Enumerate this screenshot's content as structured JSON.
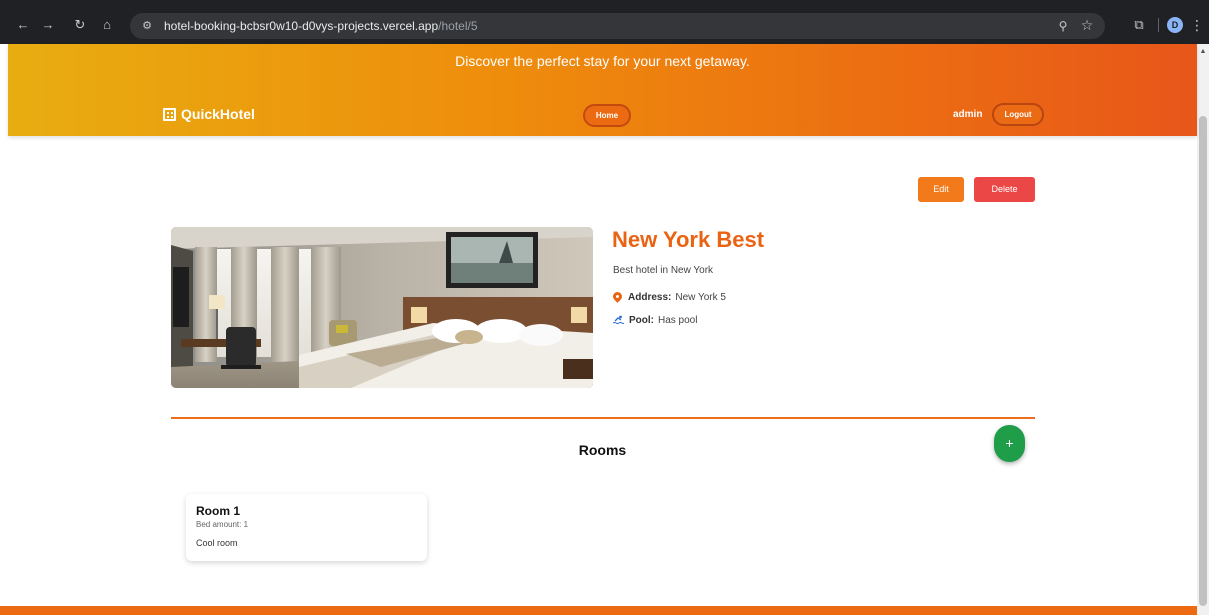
{
  "browser": {
    "url_host": "hotel-booking-bcbsr0w10-d0vys-projects.vercel.app",
    "url_path": "/hotel/5",
    "profile_initial": "D",
    "icons": [
      "back-icon",
      "forward-icon",
      "reload-icon",
      "home-icon",
      "site-settings-icon",
      "zoom-icon",
      "bookmark-star-icon",
      "extensions-icon",
      "profile-avatar",
      "menu-kebab-icon"
    ]
  },
  "header": {
    "tagline": "Discover the perfect stay for your next getaway.",
    "brand": "QuickHotel",
    "home_label": "Home",
    "username": "admin",
    "logout_label": "Logout",
    "gradient_colors": [
      "#e8ad10",
      "#e8561a"
    ]
  },
  "actions": {
    "edit_label": "Edit",
    "delete_label": "Delete",
    "edit_color": "#f27a1a",
    "delete_color": "#ec4747"
  },
  "hotel": {
    "name": "New York Best",
    "description": "Best hotel in New York",
    "address_label": "Address:",
    "address": "New York 5",
    "pool_label": "Pool:",
    "pool": "Has pool"
  },
  "rooms": {
    "title": "Rooms",
    "add_label": "+",
    "items": [
      {
        "name": "Room 1",
        "bed": "Bed amount: 1",
        "description": "Cool room"
      }
    ]
  }
}
